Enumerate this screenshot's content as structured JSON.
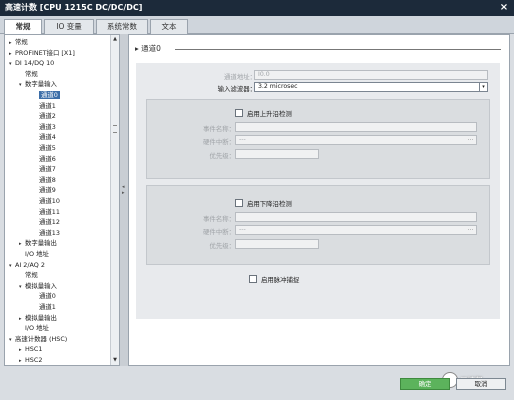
{
  "window": {
    "title": "高速计数 [CPU 1215C DC/DC/DC]",
    "close_glyph": "×"
  },
  "tabs": [
    {
      "label": "常规"
    },
    {
      "label": "IO 变量"
    },
    {
      "label": "系统常数"
    },
    {
      "label": "文本"
    }
  ],
  "tree": {
    "items": [
      {
        "label": "常规",
        "arrow": "▸"
      },
      {
        "label": "PROFINET接口 [X1]",
        "arrow": "▸"
      },
      {
        "label": "DI 14/DQ 10",
        "arrow": "▾"
      },
      {
        "label": "常规",
        "arrow": ""
      },
      {
        "label": "数字量输入",
        "arrow": "▾"
      },
      {
        "label": "通道0",
        "arrow": "",
        "selected": true
      },
      {
        "label": "通道1",
        "arrow": ""
      },
      {
        "label": "通道2",
        "arrow": ""
      },
      {
        "label": "通道3",
        "arrow": ""
      },
      {
        "label": "通道4",
        "arrow": ""
      },
      {
        "label": "通道5",
        "arrow": ""
      },
      {
        "label": "通道6",
        "arrow": ""
      },
      {
        "label": "通道7",
        "arrow": ""
      },
      {
        "label": "通道8",
        "arrow": ""
      },
      {
        "label": "通道9",
        "arrow": ""
      },
      {
        "label": "通道10",
        "arrow": ""
      },
      {
        "label": "通道11",
        "arrow": ""
      },
      {
        "label": "通道12",
        "arrow": ""
      },
      {
        "label": "通道13",
        "arrow": ""
      },
      {
        "label": "数字量输出",
        "arrow": "▸"
      },
      {
        "label": "I/O 地址",
        "arrow": ""
      },
      {
        "label": "AI 2/AQ 2",
        "arrow": "▾"
      },
      {
        "label": "常规",
        "arrow": ""
      },
      {
        "label": "模拟量输入",
        "arrow": "▾"
      },
      {
        "label": "通道0",
        "arrow": ""
      },
      {
        "label": "通道1",
        "arrow": ""
      },
      {
        "label": "模拟量输出",
        "arrow": "▸"
      },
      {
        "label": "I/O 地址",
        "arrow": ""
      },
      {
        "label": "高速计数器 (HSC)",
        "arrow": "▾"
      },
      {
        "label": "HSC1",
        "arrow": "▸"
      },
      {
        "label": "HSC2",
        "arrow": "▸"
      }
    ]
  },
  "main": {
    "section_title": "通道0",
    "section_arrow": "▸",
    "channel_address": {
      "label": "通道地址：",
      "value": "I0.0"
    },
    "input_filter": {
      "label": "输入滤波器：",
      "value": "3.2 microsec",
      "dropdown_glyph": "▾"
    },
    "rising_edge": {
      "checkbox_label": "启用上升沿检测",
      "event_name_label": "事件名称：",
      "event_name_value": "",
      "hw_interrupt_label": "硬件中断：",
      "hw_interrupt_value": "---",
      "priority_label": "优先级："
    },
    "falling_edge": {
      "checkbox_label": "启用下降沿检测",
      "event_name_label": "事件名称：",
      "event_name_value": "",
      "hw_interrupt_label": "硬件中断：",
      "hw_interrupt_value": "---",
      "priority_label": "优先级："
    },
    "pulse_catch": {
      "label": "启用脉冲捕捉"
    },
    "browse_glyph": "..."
  },
  "footer": {
    "ok_label": "确定",
    "cancel_label": "取消",
    "watermark": "工控帮"
  },
  "colors": {
    "ok_green": "#5cb35c",
    "selection_blue": "#3c6ea8",
    "titlebar": "#1c2a3a"
  }
}
